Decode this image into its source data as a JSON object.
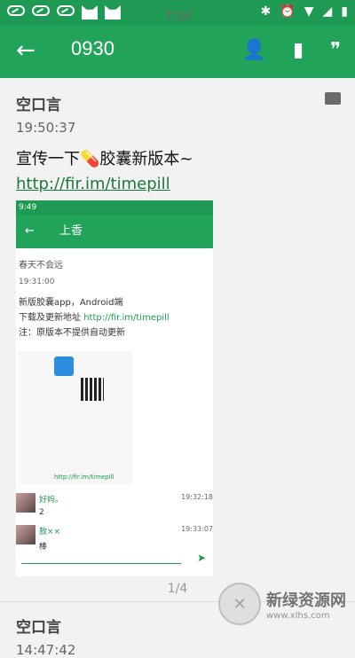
{
  "status": {
    "time": "7:54"
  },
  "toolbar": {
    "title": "0930",
    "back_icon": "arrow-left",
    "icons": [
      "person-icon",
      "book-icon",
      "quote-icon"
    ]
  },
  "post1": {
    "author": "空口言",
    "time": "19:50:37",
    "text": "宣传一下💊胶囊新版本~",
    "link": "http://fir.im/timepill",
    "embedded": {
      "status_time": "9:49",
      "title": "上香",
      "author": "春天不会远",
      "time": "19:31:00",
      "line1": "新版胶囊app，Android端",
      "line2_prefix": "下载及更新地址 ",
      "line2_link": "http://fir.im/timepill",
      "line3": "注：原版本不提供自动更新",
      "image_caption": "http://fir.im/timepill",
      "comments": [
        {
          "name": "好妈。",
          "text": "2",
          "time": "19:32:18"
        },
        {
          "name": "敖××",
          "text": "棒",
          "time": "19:33:07"
        }
      ]
    },
    "pager": "1/4"
  },
  "post2": {
    "author": "空口言",
    "time": "14:47:42"
  },
  "watermark": {
    "text": "新绿资源网",
    "sub": "www.xlhs.com"
  },
  "colors": {
    "primary": "#22a35a",
    "accent": "#1f9a55"
  }
}
